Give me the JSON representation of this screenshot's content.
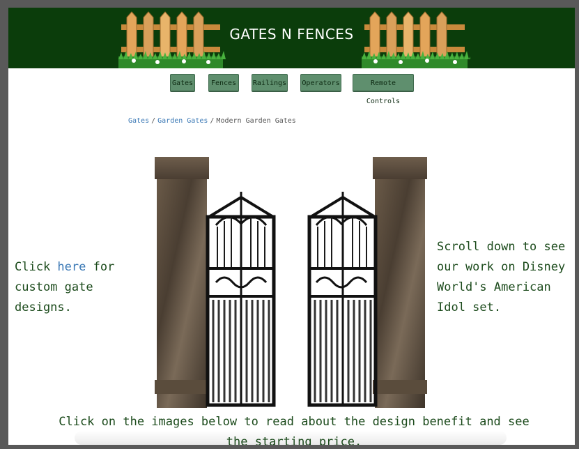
{
  "header": {
    "title": "GATES N FENCES"
  },
  "nav": {
    "items": [
      {
        "label": "Gates"
      },
      {
        "label": "Fences"
      },
      {
        "label": "Railings"
      },
      {
        "label": "Operators"
      },
      {
        "label": "Remote Controls"
      }
    ]
  },
  "breadcrumb": {
    "items": [
      "Gates",
      "Garden Gates",
      "Modern Garden Gates"
    ],
    "separator": "/"
  },
  "main": {
    "left_prefix": "Click ",
    "left_link": "here",
    "left_suffix": " for custom gate designs.",
    "right_text": "Scroll down to see our work on Disney World's American Idol set.",
    "bottom_text": "Click on the images below to read about the design benefit and see the starting price."
  },
  "colors": {
    "header_bg": "#0b3d0b",
    "nav_button_bg": "#5f8f6e",
    "link": "#3a78b5",
    "body_text": "#1c4b1c"
  },
  "icons": [
    "wooden-fence-icon",
    "wrought-iron-gate-icon"
  ]
}
